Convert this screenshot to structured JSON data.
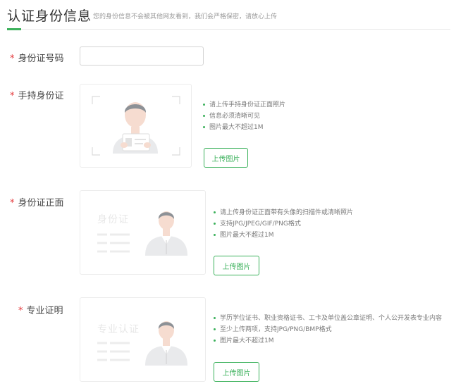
{
  "header": {
    "title": "认证身份信息",
    "subtitle": "您的身份信息不会被其他网友看到，我们会严格保密，请放心上传"
  },
  "form": {
    "required_mark": "*",
    "id_number": {
      "label": "身份证号码",
      "value": "",
      "placeholder": ""
    },
    "handheld": {
      "label": "手持身份证",
      "tips": [
        "请上传手持身份证正面照片",
        "信息必须清晰可见",
        "图片最大不超过1M"
      ],
      "upload_label": "上传图片"
    },
    "id_front": {
      "label": "身份证正面",
      "card_text": "身份证",
      "tips": [
        "请上传身份证正面带有头像的扫描件或清晰照片",
        "支持JPG/JPEG/GIF/PNG格式",
        "图片最大不超过1M"
      ],
      "upload_label": "上传图片"
    },
    "professional": {
      "label": "专业证明",
      "card_text": "专业认证",
      "tips": [
        "学历学位证书、职业资格证书、工卡及单位盖公章证明、个人公开发表专业内容",
        "至少上传两项，支持JPG/PNG/BMP格式",
        "图片最大不超过1M"
      ],
      "upload_label": "上传图片"
    }
  },
  "colors": {
    "accent": "#3bb15b",
    "required": "#e4393c"
  }
}
